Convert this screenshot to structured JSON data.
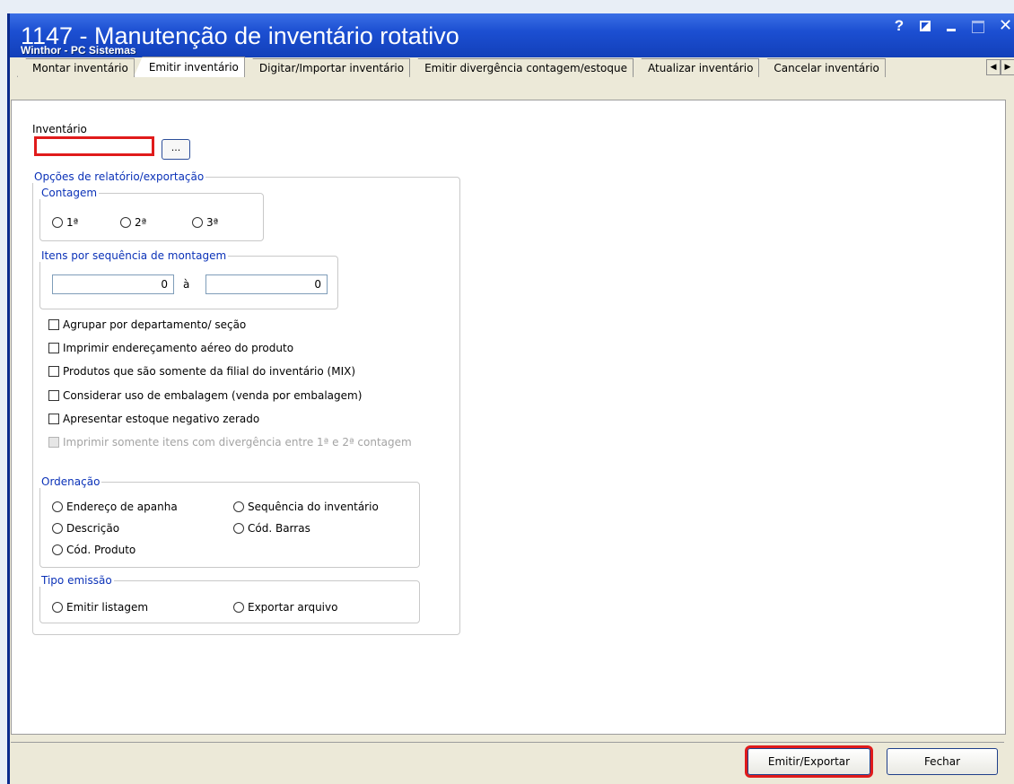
{
  "window": {
    "title": "1147 - Manutenção de inventário rotativo",
    "subtitle": "Winthor - PC Sistemas",
    "controls": {
      "help": "?",
      "close": "✕"
    }
  },
  "tabs": [
    {
      "label": "Montar inventário"
    },
    {
      "label": "Emitir inventário"
    },
    {
      "label": "Digitar/Importar inventário"
    },
    {
      "label": "Emitir divergência contagem/estoque"
    },
    {
      "label": "Atualizar inventário"
    },
    {
      "label": "Cancelar inventário"
    }
  ],
  "form": {
    "inventario_label": "Inventário",
    "inventario_value": "",
    "browse_label": "...",
    "options_group": "Opções de relatório/exportação",
    "contagem": {
      "title": "Contagem",
      "options": [
        "1ª",
        "2ª",
        "3ª"
      ]
    },
    "sequencia": {
      "title": "Itens por sequência de montagem",
      "from": "0",
      "sep": "à",
      "to": "0"
    },
    "checkboxes": [
      "Agrupar por departamento/ seção",
      "Imprimir endereçamento aéreo do produto",
      "Produtos que são somente da filial do inventário (MIX)",
      "Considerar uso de embalagem (venda por embalagem)",
      "Apresentar estoque negativo zerado",
      "Imprimir somente itens com divergência entre 1ª e 2ª contagem"
    ],
    "ordenacao": {
      "title": "Ordenação",
      "options": [
        "Endereço de apanha",
        "Sequência do inventário",
        "Descrição",
        "Cód. Barras",
        "Cód. Produto"
      ]
    },
    "tipo_emissao": {
      "title": "Tipo emissão",
      "options": [
        "Emitir listagem",
        "Exportar arquivo"
      ]
    }
  },
  "footer": {
    "emitir_label": "Emitir/Exportar",
    "fechar_label": "Fechar"
  }
}
